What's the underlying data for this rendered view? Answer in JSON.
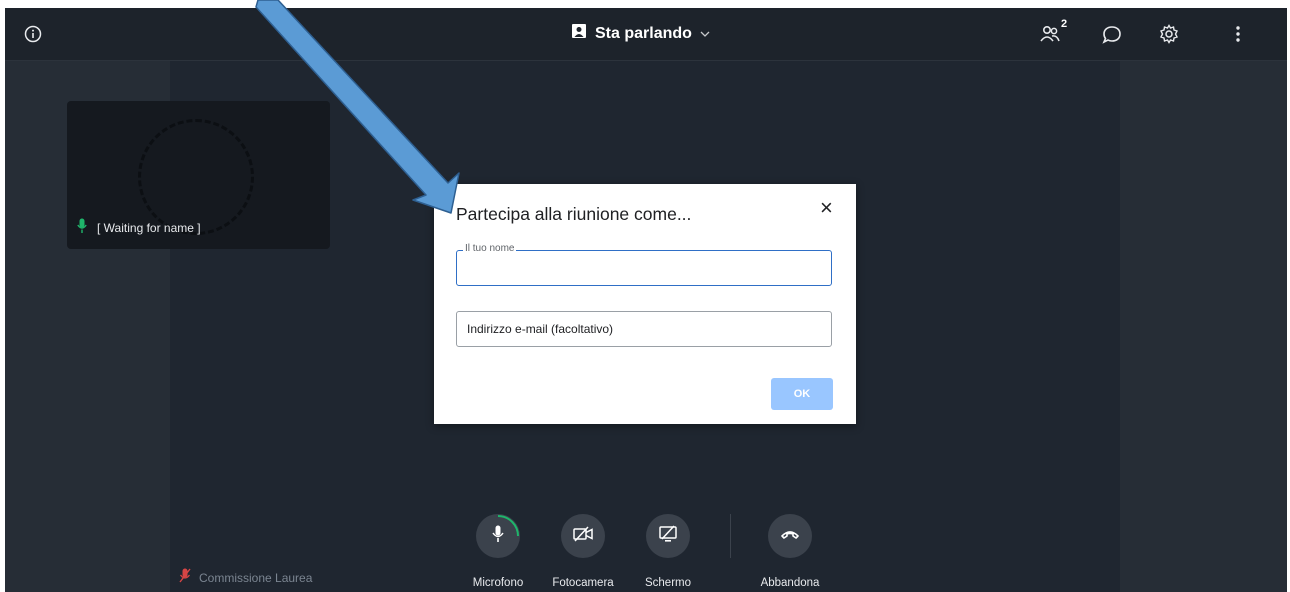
{
  "header": {
    "view_title": "Sta parlando",
    "participant_count": "2"
  },
  "tile": {
    "name": "[ Waiting for name ]"
  },
  "local_participant": {
    "name": "Commissione Laurea"
  },
  "dialog": {
    "title": "Partecipa alla riunione come...",
    "close_label": "×",
    "name_field": {
      "legend": "Il tuo nome",
      "value": ""
    },
    "email_field": {
      "placeholder": "Indirizzo e-mail (facoltativo)"
    },
    "ok_label": "OK"
  },
  "toolbar": {
    "mic_label": "Microfono",
    "camera_label": "Fotocamera",
    "screen_label": "Schermo",
    "leave_label": "Abbandona"
  },
  "colors": {
    "accent": "#2f6fc6",
    "mic_green": "#1fb56b",
    "muted_red": "#d64545",
    "annotation_arrow": "#5b9bd5"
  }
}
